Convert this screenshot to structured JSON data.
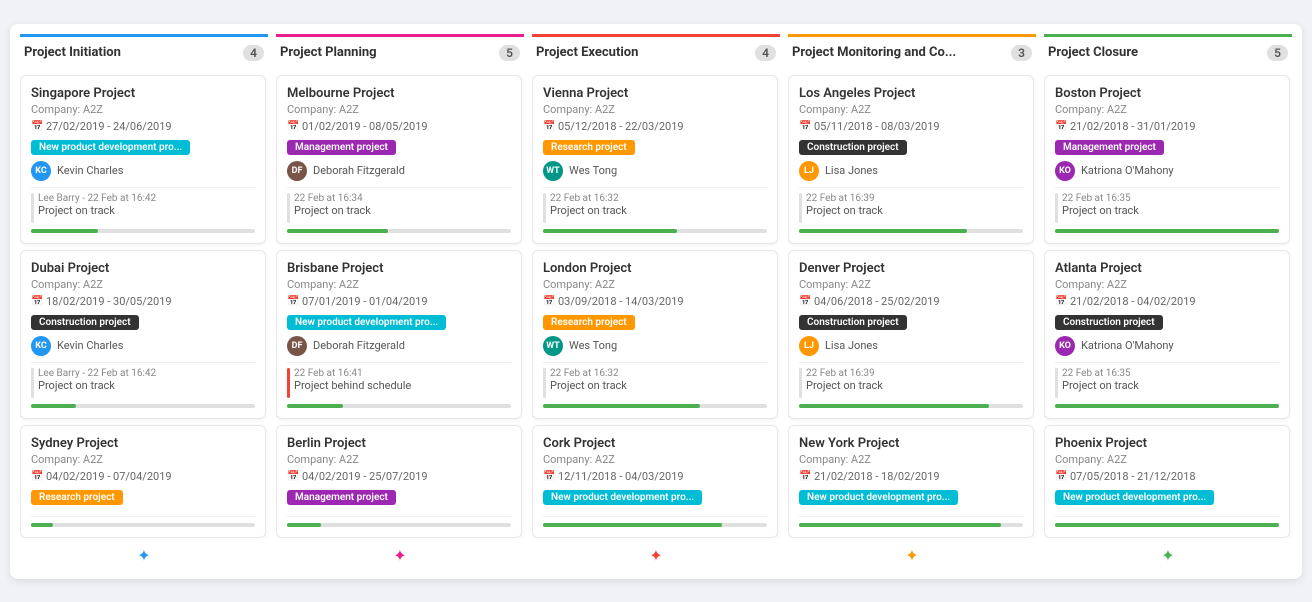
{
  "columns": [
    {
      "id": "initiation",
      "title": "Project Initiation",
      "count": "4",
      "color": "blue",
      "addIconColor": "blue",
      "cards": [
        {
          "title": "Singapore Project",
          "company": "Company: A2Z",
          "date": "27/02/2019 - 24/06/2019",
          "tag": "New product development pro...",
          "tagClass": "new-product",
          "assignee": "Kevin Charles",
          "avatarInitials": "KC",
          "avatarClass": "blue",
          "commentDate": "Lee Barry - 22 Feb at 16:42",
          "commentText": "Project on track",
          "commentBarClass": "",
          "progress": 30
        },
        {
          "title": "Dubai Project",
          "company": "Company: A2Z",
          "date": "18/02/2019 - 30/05/2019",
          "tag": "Construction project",
          "tagClass": "construction",
          "assignee": "Kevin Charles",
          "avatarInitials": "KC",
          "avatarClass": "blue",
          "commentDate": "Lee Barry - 22 Feb at 16:42",
          "commentText": "Project on track",
          "commentBarClass": "",
          "progress": 20
        },
        {
          "title": "Sydney Project",
          "company": "Company: A2Z",
          "date": "04/02/2019 - 07/04/2019",
          "tag": "Research project",
          "tagClass": "research",
          "assignee": "",
          "avatarInitials": "",
          "avatarClass": "",
          "commentDate": "",
          "commentText": "",
          "commentBarClass": "",
          "progress": 10
        }
      ]
    },
    {
      "id": "planning",
      "title": "Project Planning",
      "count": "5",
      "color": "pink",
      "addIconColor": "pink",
      "cards": [
        {
          "title": "Melbourne Project",
          "company": "Company: A2Z",
          "date": "01/02/2019 - 08/05/2019",
          "tag": "Management project",
          "tagClass": "management",
          "assignee": "Deborah Fitzgerald",
          "avatarInitials": "DF",
          "avatarClass": "brown",
          "commentDate": "22 Feb at 16:34",
          "commentText": "Project on track",
          "commentBarClass": "",
          "progress": 45
        },
        {
          "title": "Brisbane Project",
          "company": "Company: A2Z",
          "date": "07/01/2019 - 01/04/2019",
          "tag": "New product development pro...",
          "tagClass": "new-product",
          "assignee": "Deborah Fitzgerald",
          "avatarInitials": "DF",
          "avatarClass": "brown",
          "commentDate": "22 Feb at 16:41",
          "commentText": "Project behind schedule",
          "commentBarClass": "red",
          "progress": 25
        },
        {
          "title": "Berlin Project",
          "company": "Company: A2Z",
          "date": "04/02/2019 - 25/07/2019",
          "tag": "Management project",
          "tagClass": "management",
          "assignee": "",
          "avatarInitials": "",
          "avatarClass": "",
          "commentDate": "",
          "commentText": "",
          "commentBarClass": "",
          "progress": 15
        }
      ]
    },
    {
      "id": "execution",
      "title": "Project Execution",
      "count": "4",
      "color": "red",
      "addIconColor": "red",
      "cards": [
        {
          "title": "Vienna Project",
          "company": "Company: A2Z",
          "date": "05/12/2018 - 22/03/2019",
          "tag": "Research project",
          "tagClass": "research",
          "assignee": "Wes Tong",
          "avatarInitials": "WT",
          "avatarClass": "teal",
          "commentDate": "22 Feb at 16:32",
          "commentText": "Project on track",
          "commentBarClass": "",
          "progress": 60
        },
        {
          "title": "London Project",
          "company": "Company: A2Z",
          "date": "03/09/2018 - 14/03/2019",
          "tag": "Research project",
          "tagClass": "research",
          "assignee": "Wes Tong",
          "avatarInitials": "WT",
          "avatarClass": "teal",
          "commentDate": "22 Feb at 16:32",
          "commentText": "Project on track",
          "commentBarClass": "",
          "progress": 70
        },
        {
          "title": "Cork Project",
          "company": "Company: A2Z",
          "date": "12/11/2018 - 04/03/2019",
          "tag": "New product development pro...",
          "tagClass": "new-product",
          "assignee": "",
          "avatarInitials": "",
          "avatarClass": "",
          "commentDate": "",
          "commentText": "",
          "commentBarClass": "",
          "progress": 80
        }
      ]
    },
    {
      "id": "monitoring",
      "title": "Project Monitoring and Co...",
      "count": "3",
      "color": "orange",
      "addIconColor": "orange",
      "cards": [
        {
          "title": "Los Angeles Project",
          "company": "Company: A2Z",
          "date": "05/11/2018 - 08/03/2019",
          "tag": "Construction project",
          "tagClass": "construction",
          "assignee": "Lisa Jones",
          "avatarInitials": "LJ",
          "avatarClass": "orange",
          "commentDate": "22 Feb at 16:39",
          "commentText": "Project on track",
          "commentBarClass": "",
          "progress": 75
        },
        {
          "title": "Denver Project",
          "company": "Company: A2Z",
          "date": "04/06/2018 - 25/02/2019",
          "tag": "Construction project",
          "tagClass": "construction",
          "assignee": "Lisa Jones",
          "avatarInitials": "LJ",
          "avatarClass": "orange",
          "commentDate": "22 Feb at 16:39",
          "commentText": "Project on track",
          "commentBarClass": "",
          "progress": 85
        },
        {
          "title": "New York Project",
          "company": "Company: A2Z",
          "date": "21/02/2018 - 18/02/2019",
          "tag": "New product development pro...",
          "tagClass": "new-product",
          "assignee": "",
          "avatarInitials": "",
          "avatarClass": "",
          "commentDate": "",
          "commentText": "",
          "commentBarClass": "",
          "progress": 90
        }
      ]
    },
    {
      "id": "closure",
      "title": "Project Closure",
      "count": "5",
      "color": "green",
      "addIconColor": "green",
      "cards": [
        {
          "title": "Boston Project",
          "company": "Company: A2Z",
          "date": "21/02/2018 - 31/01/2019",
          "tag": "Management project",
          "tagClass": "management",
          "assignee": "Katriona O'Mahony",
          "avatarInitials": "KO",
          "avatarClass": "purple",
          "commentDate": "22 Feb at 16:35",
          "commentText": "Project on track",
          "commentBarClass": "",
          "progress": 100
        },
        {
          "title": "Atlanta Project",
          "company": "Company: A2Z",
          "date": "21/02/2018 - 04/02/2019",
          "tag": "Construction project",
          "tagClass": "construction",
          "assignee": "Katriona O'Mahony",
          "avatarInitials": "KO",
          "avatarClass": "purple",
          "commentDate": "22 Feb at 16:35",
          "commentText": "Project on track",
          "commentBarClass": "",
          "progress": 100
        },
        {
          "title": "Phoenix Project",
          "company": "Company: A2Z",
          "date": "07/05/2018 - 21/12/2018",
          "tag": "New product development pro...",
          "tagClass": "new-product",
          "assignee": "",
          "avatarInitials": "",
          "avatarClass": "",
          "commentDate": "",
          "commentText": "",
          "commentBarClass": "",
          "progress": 100
        }
      ]
    }
  ]
}
